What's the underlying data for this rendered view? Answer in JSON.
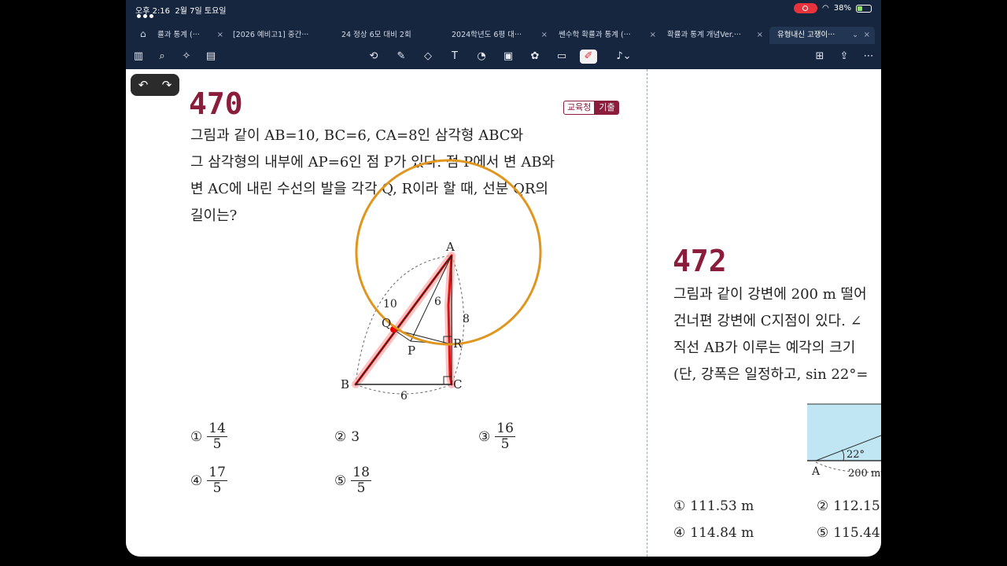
{
  "status": {
    "time": "오후 2:16",
    "date": "2월 7일 토요일",
    "battery": "38%"
  },
  "tabs": [
    {
      "label": "률과 통계 (···",
      "active": false
    },
    {
      "label": "[2026 예비고1] 중간···",
      "active": false
    },
    {
      "label": "24 정상 6모 대비 2회",
      "active": false
    },
    {
      "label": "2024학년도 6평 대···",
      "active": false
    },
    {
      "label": "쎈수학 확률과 통계 (···",
      "active": false
    },
    {
      "label": "확률과 통계 개념Ver.···",
      "active": false
    },
    {
      "label": "유형내신 고쟁이···",
      "active": true
    }
  ],
  "toolbar_icons": [
    "sidebar-icon",
    "search-icon",
    "sparkle-icon",
    "notes-icon",
    "lasso-icon",
    "pen-icon",
    "eraser-icon",
    "textbox-icon",
    "shapes-icon",
    "image-icon",
    "sticker-icon",
    "memo-icon",
    "laser-pointer-icon",
    "mic-icon",
    "add-page-icon",
    "share-icon",
    "more-icon"
  ],
  "problem470": {
    "number": "470",
    "badge_left": "교육청",
    "badge_right": "기출",
    "lines": [
      "그림과 같이 AB=10, BC=6, CA=8인 삼각형 ABC와",
      "그 삼각형의 내부에 AP=6인 점 P가 있다. 점 P에서 변 AB와",
      "변 AC에 내린 수선의 발을 각각 Q, R이라 할 때, 선분 QR의",
      "길이는?"
    ],
    "figure_labels": {
      "A": "A",
      "B": "B",
      "C": "C",
      "P": "P",
      "Q": "Q",
      "R": "R",
      "ab": "10",
      "ap": "6",
      "ac": "8",
      "bc": "6"
    },
    "choices": [
      {
        "mark": "①",
        "num": "14",
        "den": "5"
      },
      {
        "mark": "②",
        "value": "3"
      },
      {
        "mark": "③",
        "num": "16",
        "den": "5"
      },
      {
        "mark": "④",
        "num": "17",
        "den": "5"
      },
      {
        "mark": "⑤",
        "num": "18",
        "den": "5"
      }
    ]
  },
  "problem472": {
    "number": "472",
    "lines": [
      "그림과 같이 강변에 200 m 떨어",
      "건너편 강변에 C지점이 있다. ∠",
      "직선 AB가 이루는 예각의 크기",
      "(단, 강폭은 일정하고, sin 22°="
    ],
    "figure": {
      "angle": "22°",
      "point": "A",
      "distance": "200 m"
    },
    "choices": [
      {
        "mark": "①",
        "value": "111.53 m"
      },
      {
        "mark": "②",
        "value": "112.15"
      },
      {
        "mark": "④",
        "value": "114.84 m"
      },
      {
        "mark": "⑤",
        "value": "115.44"
      }
    ]
  }
}
